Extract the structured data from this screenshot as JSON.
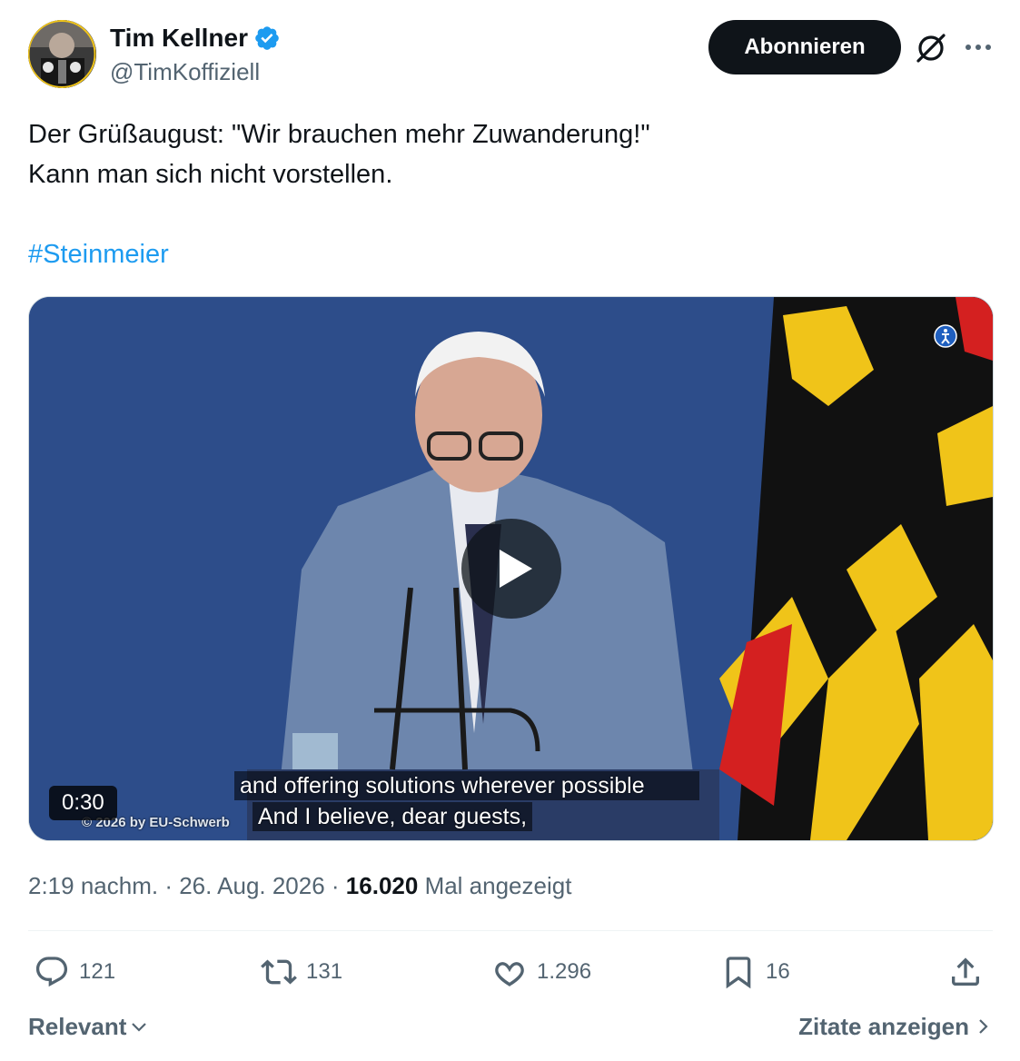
{
  "author": {
    "display_name": "Tim Kellner",
    "handle": "@TimKoffiziell",
    "verified": true,
    "verified_color": "#1d9bf0"
  },
  "header": {
    "subscribe_label": "Abonnieren",
    "grok_icon": "grok-icon",
    "more_icon": "more-dots-icon"
  },
  "tweet": {
    "line1": "Der Grüßaugust: \"Wir brauchen mehr Zuwanderung!\"",
    "line2": "Kann man sich nicht vorstellen.",
    "hashtag": "#Steinmeier"
  },
  "video": {
    "duration": "0:30",
    "subtitle_line1": "and offering solutions wherever possible",
    "subtitle_line2": "And I believe, dear guests,",
    "copyright": "© 2026 by EU-Schwerb"
  },
  "meta": {
    "time": "2:19 nachm.",
    "separator": " · ",
    "date": "26. Aug. 2026",
    "views_count": "16.020",
    "views_label": "Mal angezeigt"
  },
  "actions": {
    "replies": "121",
    "reposts": "131",
    "likes": "1.296",
    "bookmarks": "16"
  },
  "footer": {
    "sort_label": "Relevant",
    "quotes_label": "Zitate anzeigen"
  },
  "colors": {
    "text": "#0f1419",
    "secondary": "#536471",
    "link": "#1d9bf0",
    "button_bg": "#0f1419"
  }
}
